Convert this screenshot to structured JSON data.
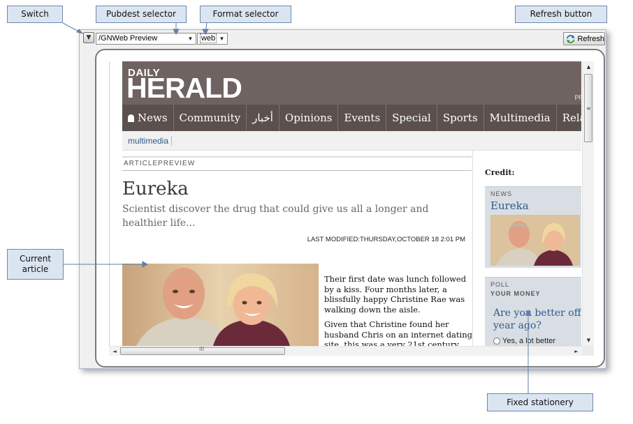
{
  "callouts": {
    "switch": "Switch",
    "pubdest": "Pubdest selector",
    "format": "Format selector",
    "refresh": "Refresh button",
    "article": "Current article",
    "fixed": "Fixed stationery"
  },
  "toolbar": {
    "switch_icon": "▼",
    "pubdest_value": "/GNWeb Preview",
    "format_value": "web",
    "dropdown_icon": "▼",
    "refresh_label": "Refresh"
  },
  "site": {
    "logo_top": "DAILY",
    "logo_main": "HERALD",
    "masthead_right": "PR",
    "nav": [
      "News",
      "Community",
      "أخبار",
      "Opinions",
      "Events",
      "Special",
      "Sports",
      "Multimedia",
      "Relax"
    ],
    "subnav": [
      "multimedia"
    ]
  },
  "article": {
    "section": "ARTICLEPREVIEW",
    "headline": "Eureka",
    "deck": "Scientist discover the drug that could give us all a longer and healthier life...",
    "modified": "LAST MODIFIED:THURSDAY,OCTOBER 18 2:01 PM",
    "paragraphs": [
      "Their first date was lunch followed by a kiss. Four months later, a blissfully happy Christine Rae was walking down the aisle.",
      "Given that Christine found her husband Chris on an internet dating site, this was a very 21st century"
    ]
  },
  "sidebar": {
    "credit": "Credit:",
    "news_kicker": "NEWS",
    "news_title": "Eureka",
    "poll_kicker": "POLL",
    "poll_topic": "YOUR MONEY",
    "poll_question_line1": "Are you better off f",
    "poll_question_line2": "year ago?",
    "poll_option": "Yes, a lot better"
  },
  "scrollbar": {
    "up": "▲",
    "down": "▼",
    "left": "◄",
    "right": "►",
    "vgrip": "≡",
    "hgrip": "III"
  },
  "colors": {
    "masthead": "#6f6361",
    "nav": "#5b504e",
    "link": "#2e5a8c",
    "callout_fill": "#dbe5f1",
    "callout_line": "#6c88ad"
  }
}
